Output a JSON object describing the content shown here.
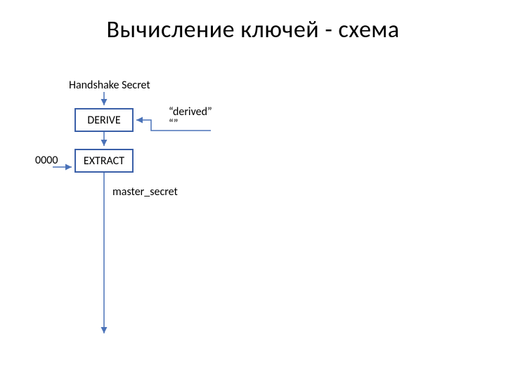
{
  "title": "Вычисление ключей - схема",
  "labels": {
    "handshake_secret": "Handshake Secret",
    "zeros": "0000",
    "derived_line1": "“derived”",
    "derived_line2": "“”",
    "master_secret": "master_secret"
  },
  "boxes": {
    "derive": "DERIVE",
    "extract": "EXTRACT"
  },
  "colors": {
    "box_border": "#3a5fa8",
    "arrow": "#4a72b8"
  }
}
